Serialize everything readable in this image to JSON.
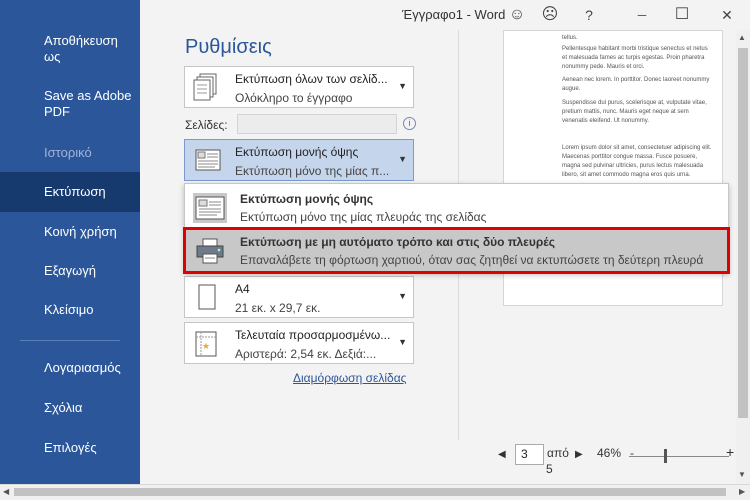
{
  "window": {
    "title": "Έγγραφο1 - Word",
    "buttons": {
      "smiley": "☺",
      "frown": "☹",
      "help": "?",
      "minimize": "─",
      "maximize": "☐",
      "close": "✕"
    }
  },
  "sidebar": {
    "save_as_line1": "Αποθήκευση",
    "save_as_line2": "ως",
    "save_adobe_line1": "Save as Adobe",
    "save_adobe_line2": "PDF",
    "history": "Ιστορικό",
    "print": "Εκτύπωση",
    "share": "Κοινή χρήση",
    "export": "Εξαγωγή",
    "close": "Κλείσιμο",
    "account": "Λογαριασμός",
    "comments": "Σχόλια",
    "options": "Επιλογές"
  },
  "settings": {
    "title": "Ρυθμίσεις",
    "print_all": {
      "line1": "Εκτύπωση όλων των σελίδ...",
      "line2": "Ολόκληρο το έγγραφο"
    },
    "pages_label": "Σελίδες:",
    "pages_value": "",
    "info_icon": "i",
    "sides": {
      "line1": "Εκτύπωση μονής όψης",
      "line2": "Εκτύπωση μόνο της μίας π..."
    },
    "paper": {
      "line1": "A4",
      "line2": "21 εκ. x 29,7 εκ."
    },
    "margins": {
      "line1": "Τελευταία προσαρμοσμένω...",
      "line2": "Αριστερά:   2,54 εκ.   Δεξιά:..."
    },
    "page_setup_link": "Διαμόρφωση σελίδας"
  },
  "popup": {
    "items": [
      {
        "title": "Εκτύπωση μονής όψης",
        "desc": "Εκτύπωση μόνο της μίας πλευράς της σελίδας"
      },
      {
        "title": "Εκτύπωση με μη αυτόματο τρόπο και στις δύο πλευρές",
        "desc": "Επαναλάβετε τη φόρτωση χαρτιού, όταν σας ζητηθεί να εκτυπώσετε τη δεύτερη πλευρά"
      }
    ]
  },
  "preview": {
    "paragraphs": [
      "tellus.",
      "Pellentesque habitant morbi tristique senectus et netus et malesuada fames ac turpis egestas. Proin pharetra nonummy pede. Mauris et orci.",
      "Aenean nec lorem. In porttitor. Donec laoreet nonummy augue.",
      "Suspendisse dui purus, scelerisque at, vulputate vitae, pretium mattis, nunc. Mauris eget neque at sem venenatis eleifend. Ut nonummy.",
      "Lorem ipsum dolor sit amet, consectetuer adipiscing elit. Maecenas porttitor congue massa. Fusce posuere, magna sed pulvinar ultricies, purus lectus malesuada libero, sit amet commodo magna eros quis urna."
    ]
  },
  "nav": {
    "prev": "◀",
    "current_page": "3",
    "of_label": "από",
    "total": "5",
    "next": "▶",
    "zoom": "46%",
    "zoom_minus": "-",
    "zoom_plus": "+"
  },
  "scroll": {
    "up": "▲",
    "down": "▼",
    "left": "◀",
    "right": "▶"
  }
}
